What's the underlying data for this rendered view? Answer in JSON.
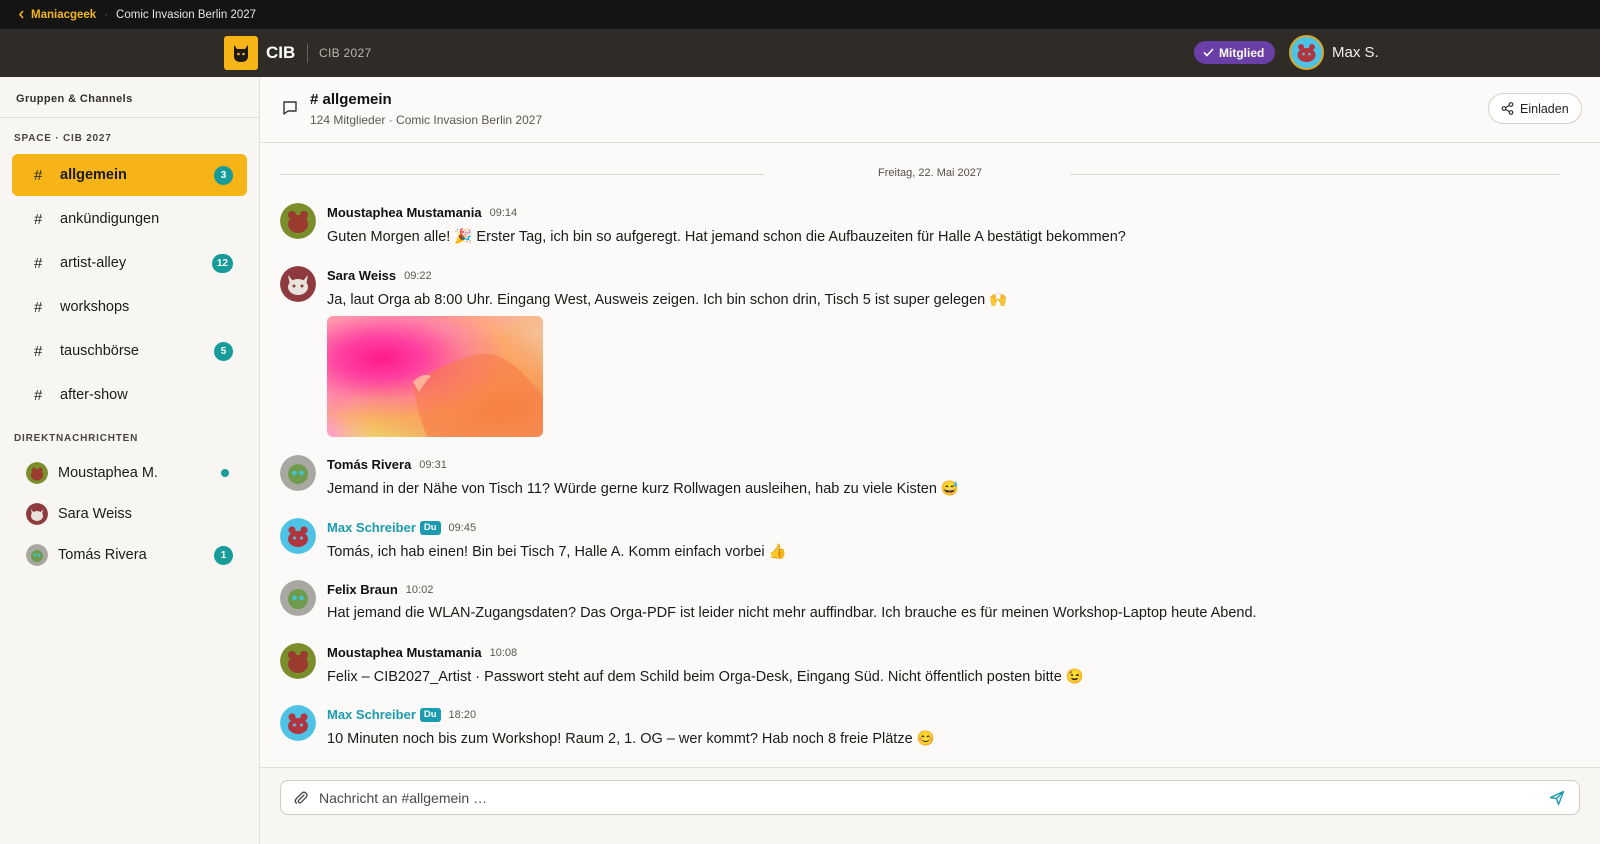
{
  "breadcrumb": {
    "back_label": "Maniacgeek",
    "current": "Comic Invasion Berlin 2027"
  },
  "brand": {
    "name": "CIB",
    "subtitle": "CIB 2027",
    "accent": "#f6b416"
  },
  "user": {
    "member_label": "Mitglied",
    "name": "Max S."
  },
  "sidebar": {
    "heading": "Gruppen & Channels",
    "space_label": "SPACE · CIB 2027",
    "channels": [
      {
        "name": "allgemein",
        "badge": "3",
        "active": true
      },
      {
        "name": "ankündigungen",
        "badge": ""
      },
      {
        "name": "artist-alley",
        "badge": "12"
      },
      {
        "name": "workshops",
        "badge": ""
      },
      {
        "name": "tauschbörse",
        "badge": "5"
      },
      {
        "name": "after-show",
        "badge": ""
      }
    ],
    "dm_label": "DIREKTNACHRICHTEN",
    "dms": [
      {
        "name": "Moustaphea M.",
        "status": "online"
      },
      {
        "name": "Sara Weiss",
        "status": ""
      },
      {
        "name": "Tomás Rivera",
        "badge": "1"
      }
    ]
  },
  "channel": {
    "hash": "#",
    "title": "allgemein",
    "subtitle": "124 Mitglieder · Comic Invasion Berlin 2027",
    "invite_label": "Einladen"
  },
  "date_divider": "Freitag, 22. Mai 2027",
  "self_tag": "Du",
  "messages": [
    {
      "author": "Moustaphea Mustamania",
      "time": "09:14",
      "text": "Guten Morgen alle! 🎉 Erster Tag, ich bin so aufgeregt. Hat jemand schon die Aufbauzeiten für Halle A bestätigt bekommen?",
      "avatar": "olive"
    },
    {
      "author": "Sara Weiss",
      "time": "09:22",
      "text": "Ja, laut Orga ab 8:00 Uhr. Eingang West, Ausweis zeigen. Ich bin schon drin, Tisch 5 ist super gelegen 🙌",
      "avatar": "maroon",
      "has_image": true
    },
    {
      "author": "Tomás Rivera",
      "time": "09:31",
      "text": "Jemand in der Nähe von Tisch 11? Würde gerne kurz Rollwagen ausleihen, hab zu viele Kisten 😅",
      "avatar": "grey"
    },
    {
      "author": "Max Schreiber",
      "time": "09:45",
      "text": "Tomás, ich hab einen! Bin bei Tisch 7, Halle A. Komm einfach vorbei 👍",
      "avatar": "cyan",
      "self": true
    },
    {
      "author": "Felix Braun",
      "time": "10:02",
      "text": "Hat jemand die WLAN-Zugangsdaten? Das Orga-PDF ist leider nicht mehr auffindbar. Ich brauche es für meinen Workshop-Laptop heute Abend.",
      "avatar": "grey"
    },
    {
      "author": "Moustaphea Mustamania",
      "time": "10:08",
      "text": "Felix – CIB2027_Artist · Passwort steht auf dem Schild beim Orga-Desk, Eingang Süd. Nicht öffentlich posten bitte 😉",
      "avatar": "olive"
    },
    {
      "author": "Max Schreiber",
      "time": "18:20",
      "text": "10 Minuten noch bis zum Workshop! Raum 2, 1. OG – wer kommt? Hab noch 8 freie Plätze 😊",
      "avatar": "cyan",
      "self": true
    }
  ],
  "composer": {
    "placeholder": "Nachricht an #allgemein …"
  },
  "colors": {
    "badge_teal": "#179c9a",
    "self_author": "#1a9bb0",
    "member_purple": "#6a3fa8"
  }
}
